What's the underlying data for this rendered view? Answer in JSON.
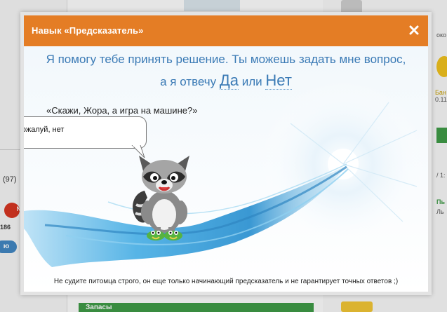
{
  "background": {
    "left_count": "(97)",
    "badge_text": "N",
    "small_number": "186",
    "pill_label": "ю",
    "green_bar_label": "Запасы",
    "right_text_1": "Бан",
    "right_text_2": "0.11",
    "right_text_3": "/ 1:",
    "right_text_4": "Пь",
    "right_text_5": "Ль",
    "right_text_6": "око"
  },
  "modal": {
    "title": "Навык «Предсказатель»",
    "close_label": "×",
    "intro_line1": "Я помогу тебе принять решение. Ты можешь задать мне вопрос,",
    "intro_line2_prefix": "а я отвечу",
    "answer_yes": "Да",
    "or_word": "или",
    "answer_no": "Нет",
    "question": "«Скажи, Жора, а игра на машине?»",
    "answer_bubble": "Пожалуй, нет",
    "disclaimer": "Не судите питомца строго, он еще только начинающий предсказатель и не гарантирует точных ответов ;)"
  },
  "colors": {
    "header": "#e47d25",
    "intro_text": "#3a7ab5",
    "wave": "#3f9fd8",
    "bg_green": "#3c9a44"
  },
  "icons": {
    "close": "close-icon",
    "mascot": "raccoon-mascot"
  }
}
